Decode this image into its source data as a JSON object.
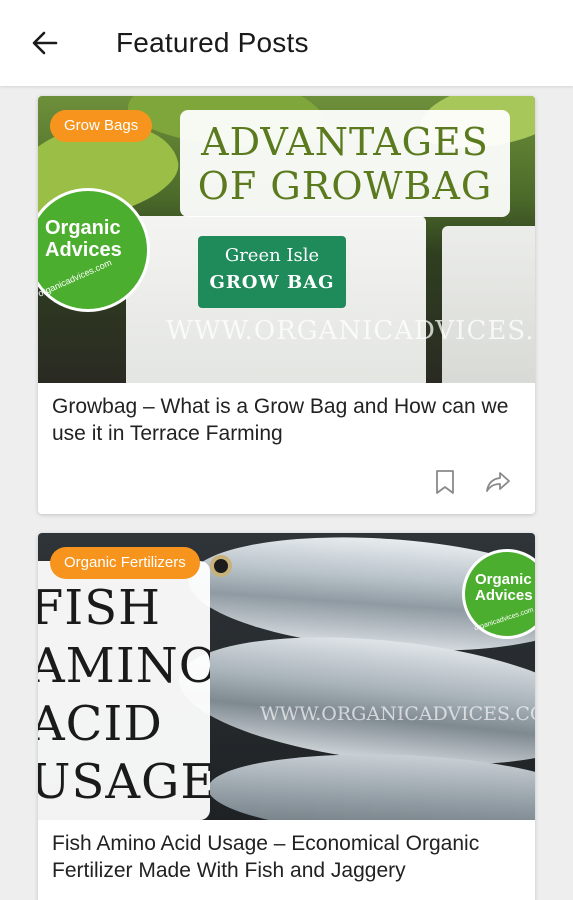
{
  "appbar": {
    "title": "Featured Posts",
    "back_icon": "arrow-left-icon"
  },
  "posts": [
    {
      "category": "Grow Bags",
      "title": "Growbag – What is a Grow Bag and How can we use it in Terrace Farming",
      "thumbnail": {
        "headline_line1": "ADVANTAGES",
        "headline_line2": "OF GROWBAG",
        "bag_label_line1": "Green Isle",
        "bag_label_line2": "GROW BAG",
        "brand": "Organic Advices",
        "brand_url": "organicadvices.com",
        "watermark": "WWW.ORGANICADVICES.COM"
      },
      "actions": {
        "bookmark_icon": "bookmark-icon",
        "share_icon": "share-icon"
      }
    },
    {
      "category": "Organic Fertilizers",
      "title": "Fish Amino Acid Usage – Economical Organic Fertilizer Made With Fish and Jaggery",
      "thumbnail": {
        "headline": "FISH\nAMINO\nACID\nUSAGE",
        "brand": "Organic Advices",
        "brand_url": "organicadvices.com",
        "watermark": "WWW.ORGANICADVICES.COM"
      }
    }
  ],
  "colors": {
    "badge": "#f7941d",
    "brand_green": "#4cae2f",
    "headline_green": "#5b7a1e"
  }
}
